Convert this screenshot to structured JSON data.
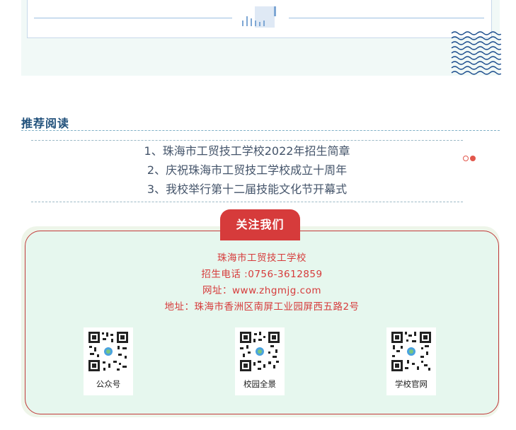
{
  "recommend": {
    "title": "推荐阅读",
    "items": [
      "1、珠海市工贸技工学校2022年招生简章",
      "2、庆祝珠海市工贸技工学校成立十周年",
      "3、我校举行第十二届技能文化节开幕式"
    ]
  },
  "follow": {
    "tab_label": "关注我们",
    "school_name": "珠海市工贸技工学校",
    "phone": "招生电话 :0756-3612859",
    "website": "网址：www.zhgmjg.com",
    "address": "地址：珠海市香洲区南屏工业园屏西五路2号",
    "qr_codes": [
      {
        "label": "公众号"
      },
      {
        "label": "校园全景"
      },
      {
        "label": "学校官网"
      }
    ]
  },
  "colors": {
    "accent_red": "#d63b3b",
    "title_blue": "#1f4f7a",
    "panel_mint": "#e6f7ee"
  },
  "icons": [
    "bar-chart-icon",
    "wave-pattern-icon",
    "carousel-dot-icon",
    "qr-code-icon"
  ]
}
